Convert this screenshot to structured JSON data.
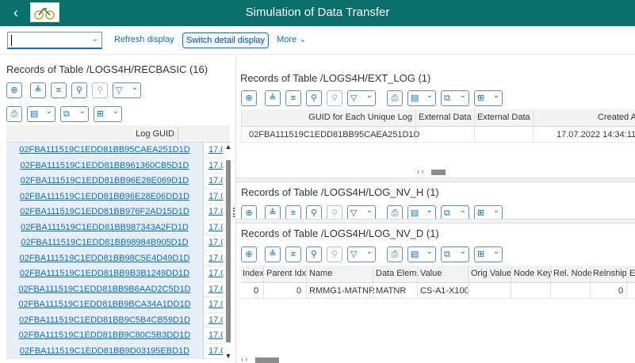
{
  "shell": {
    "back_icon": "back-arrow-icon",
    "logo_icon": "app-logo-icon",
    "title": "Simulation of Data Transfer"
  },
  "toolbar": {
    "combo_value": "",
    "refresh_label": "Refresh display",
    "switch_label": "Switch detail display",
    "more_label": "More"
  },
  "left_pane": {
    "title": "Records of Table /LOGS4H/RECBASIC (16)",
    "column_header": "Log GUID",
    "rows": [
      {
        "guid": "02FBA111519C1EDD81BB95CAEA251D1D",
        "date": "17.0"
      },
      {
        "guid": "02FBA111519C1EDD81BB961360CB5D1D",
        "date": "17.0"
      },
      {
        "guid": "02FBA111519C1EDD81BB96E28E069D1D",
        "date": "17.0"
      },
      {
        "guid": "02FBA111519C1EDD81BB96E28E06DD1D",
        "date": "17.0"
      },
      {
        "guid": "02FBA111519C1EDD81BB976F2AD15D1D",
        "date": "17.0"
      },
      {
        "guid": "02FBA111519C1EDD81BB987343A2FD1D",
        "date": "17.0"
      },
      {
        "guid": "02FBA111519C1EDD81BB98984B905D1D",
        "date": "17.0"
      },
      {
        "guid": "02FBA111519C1EDD81BB98C5E4D49D1D",
        "date": "17.0"
      },
      {
        "guid": "02FBA111519C1EDD81BB9B3B1249DD1D",
        "date": "17.0"
      },
      {
        "guid": "02FBA111519C1EDD81BB9B6AAD2C5D1D",
        "date": "17.0"
      },
      {
        "guid": "02FBA111519C1EDD81BB9BCA34A1DD1D",
        "date": "17.0"
      },
      {
        "guid": "02FBA111519C1EDD81BB9C5B4CB59D1D",
        "date": "17.0"
      },
      {
        "guid": "02FBA111519C1EDD81BB9C80C5B3DD1D",
        "date": "17.0"
      },
      {
        "guid": "02FBA111519C1EDD81BB9D03195EBD1D",
        "date": "17.0"
      }
    ]
  },
  "ext_log": {
    "title": "Records of Table /LOGS4H/EXT_LOG (1)",
    "headers": [
      "GUID for Each Unique Log",
      "External Data",
      "External Data",
      "Created A"
    ],
    "row": [
      "02FBA111519C1EDD81BB95CAEA251D1D",
      "",
      "",
      "17.07.2022 14:34:11"
    ]
  },
  "log_nv_h": {
    "title": "Records of Table /LOGS4H/LOG_NV_H (1)"
  },
  "log_nv_d": {
    "title": "Records of Table /LOGS4H/LOG_NV_D (1)",
    "headers": [
      "Index",
      "Parent Idx",
      "Name",
      "Data Elem.",
      "Value",
      "Orig Value",
      "Node Key",
      "Rel. Node",
      "Relnship",
      "E"
    ],
    "row": [
      "0",
      "0",
      "RMMG1-MATNR",
      "MATNR",
      "CS-A1-X100",
      "",
      "",
      "",
      "0",
      ""
    ]
  },
  "icons": {
    "zoom": "zoom-icon",
    "sort_asc": "sort-ascending-icon",
    "sort_desc": "sort-descending-icon",
    "find": "find-icon",
    "find_next": "find-next-icon",
    "filter": "filter-icon",
    "print": "print-icon",
    "export": "export-icon",
    "layout": "layout-icon"
  }
}
